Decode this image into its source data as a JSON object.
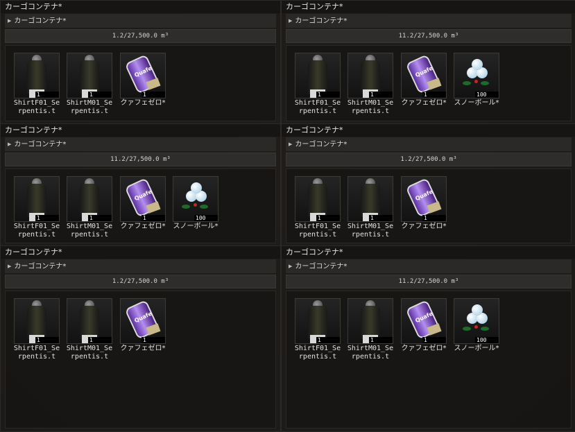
{
  "panels": [
    {
      "title": "カーゴコンテナ*",
      "tree_label": "カーゴコンテナ*",
      "capacity": "1.2/27,500.0 m³",
      "items": [
        {
          "name": "ShirtF01_Serpentis.t",
          "qty": "1",
          "icon": "female-shirt-icon"
        },
        {
          "name": "ShirtM01_Serpentis.t",
          "qty": "1",
          "icon": "male-shirt-icon"
        },
        {
          "name": "クァフェゼロ*",
          "qty": "1",
          "icon": "quafe-zero-icon"
        }
      ]
    },
    {
      "title": "カーゴコンテナ*",
      "tree_label": "カーゴコンテナ*",
      "capacity": "11.2/27,500.0 m³",
      "items": [
        {
          "name": "ShirtF01_Serpentis.t",
          "qty": "1",
          "icon": "female-shirt-icon"
        },
        {
          "name": "ShirtM01_Serpentis.t",
          "qty": "1",
          "icon": "male-shirt-icon"
        },
        {
          "name": "クァフェゼロ*",
          "qty": "1",
          "icon": "quafe-zero-icon"
        },
        {
          "name": "スノーボール*",
          "qty": "100",
          "icon": "snowball-icon"
        }
      ]
    },
    {
      "title": "カーゴコンテナ*",
      "tree_label": "カーゴコンテナ*",
      "capacity": "11.2/27,500.0 m³",
      "items": [
        {
          "name": "ShirtF01_Serpentis.t",
          "qty": "1",
          "icon": "female-shirt-icon"
        },
        {
          "name": "ShirtM01_Serpentis.t",
          "qty": "1",
          "icon": "male-shirt-icon"
        },
        {
          "name": "クァフェゼロ*",
          "qty": "1",
          "icon": "quafe-zero-icon"
        },
        {
          "name": "スノーボール*",
          "qty": "100",
          "icon": "snowball-icon"
        }
      ]
    },
    {
      "title": "カーゴコンテナ*",
      "tree_label": "カーゴコンテナ*",
      "capacity": "1.2/27,500.0 m³",
      "items": [
        {
          "name": "ShirtF01_Serpentis.t",
          "qty": "1",
          "icon": "female-shirt-icon"
        },
        {
          "name": "ShirtM01_Serpentis.t",
          "qty": "1",
          "icon": "male-shirt-icon"
        },
        {
          "name": "クァフェゼロ*",
          "qty": "1",
          "icon": "quafe-zero-icon"
        }
      ]
    },
    {
      "title": "カーゴコンテナ*",
      "tree_label": "カーゴコンテナ*",
      "capacity": "1.2/27,500.0 m³",
      "items": [
        {
          "name": "ShirtF01_Serpentis.t",
          "qty": "1",
          "icon": "female-shirt-icon"
        },
        {
          "name": "ShirtM01_Serpentis.t",
          "qty": "1",
          "icon": "male-shirt-icon"
        },
        {
          "name": "クァフェゼロ*",
          "qty": "1",
          "icon": "quafe-zero-icon"
        }
      ]
    },
    {
      "title": "カーゴコンテナ*",
      "tree_label": "カーゴコンテナ*",
      "capacity": "11.2/27,500.0 m³",
      "items": [
        {
          "name": "ShirtF01_Serpentis.t",
          "qty": "1",
          "icon": "female-shirt-icon"
        },
        {
          "name": "ShirtM01_Serpentis.t",
          "qty": "1",
          "icon": "male-shirt-icon"
        },
        {
          "name": "クァフェゼロ*",
          "qty": "1",
          "icon": "quafe-zero-icon"
        },
        {
          "name": "スノーボール*",
          "qty": "100",
          "icon": "snowball-icon"
        }
      ]
    }
  ]
}
